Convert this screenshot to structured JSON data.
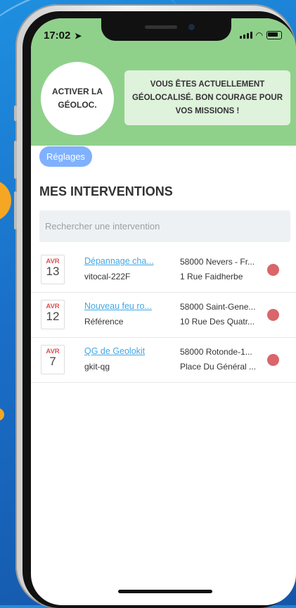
{
  "status": {
    "time": "17:02"
  },
  "header": {
    "geoloc_button": "ACTIVER LA GÉOLOC.",
    "notice": "VOUS ÊTES ACTUELLEMENT GÉOLOCALISÉ. BON COURAGE POUR VOS MISSIONS !"
  },
  "settings": {
    "label": "Réglages"
  },
  "section": {
    "title": "MES INTERVENTIONS"
  },
  "search": {
    "placeholder": "Rechercher une intervention"
  },
  "interventions": [
    {
      "month": "AVR",
      "day": "13",
      "title": "Dépannage cha...",
      "reference": "vitocal-222F",
      "city": "58000 Nevers - Fr...",
      "street": "1 Rue Faidherbe",
      "status_color": "#d9666a"
    },
    {
      "month": "AVR",
      "day": "12",
      "title": "Nouveau feu ro...",
      "reference": "Référence",
      "city": "58000 Saint-Gene...",
      "street": "10 Rue Des Quatr...",
      "status_color": "#d9666a"
    },
    {
      "month": "AVR",
      "day": "7",
      "title": "QG de Geolokit",
      "reference": "gkit-qg",
      "city": "58000 Rotonde-1...",
      "street": "Place Du Général ...",
      "status_color": "#d9666a"
    }
  ],
  "colors": {
    "header_bg": "#8fd18a",
    "notice_bg": "#dff2dc",
    "settings_bg": "#7fb1ff",
    "link": "#41a8e6",
    "date_month": "#e05050"
  }
}
